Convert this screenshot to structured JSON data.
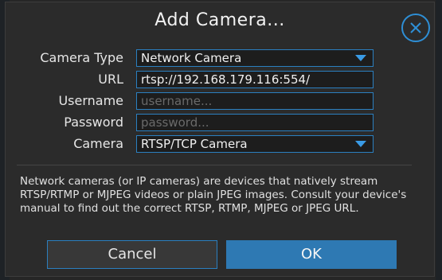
{
  "dialog": {
    "title": "Add Camera...",
    "close_icon": "close-circle-icon",
    "accent": "#2e8fd6"
  },
  "form": {
    "camera_type": {
      "label": "Camera Type",
      "value": "Network Camera"
    },
    "url": {
      "label": "URL",
      "value": "rtsp://192.168.179.116:554/"
    },
    "username": {
      "label": "Username",
      "placeholder": "username..."
    },
    "password": {
      "label": "Password",
      "placeholder": "password..."
    },
    "camera": {
      "label": "Camera",
      "value": "RTSP/TCP Camera"
    }
  },
  "description": "Network cameras (or IP cameras) are devices that natively stream RTSP/RTMP or MJPEG videos or plain JPEG images. Consult your device's manual to find out the correct RTSP, RTMP, MJPEG or JPEG URL.",
  "buttons": {
    "cancel": "Cancel",
    "ok": "OK"
  }
}
